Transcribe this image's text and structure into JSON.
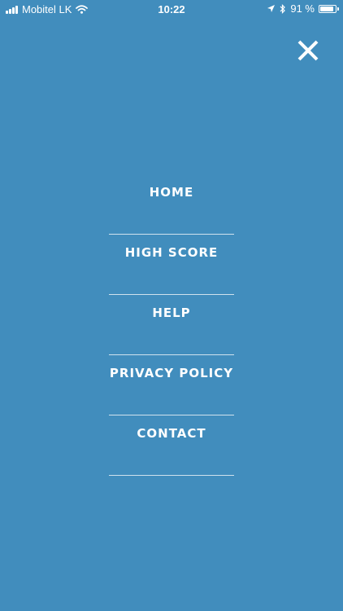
{
  "status_bar": {
    "carrier": "Mobitel LK",
    "time": "10:22",
    "battery_percent": "91 %",
    "battery_level": 0.91
  },
  "close_button": {
    "icon": "close-icon"
  },
  "menu": {
    "items": [
      {
        "label": "HOME"
      },
      {
        "label": "HIGH SCORE"
      },
      {
        "label": "HELP"
      },
      {
        "label": "PRIVACY POLICY"
      },
      {
        "label": "CONTACT"
      }
    ]
  },
  "colors": {
    "background": "#418dbd",
    "foreground": "#ffffff"
  }
}
